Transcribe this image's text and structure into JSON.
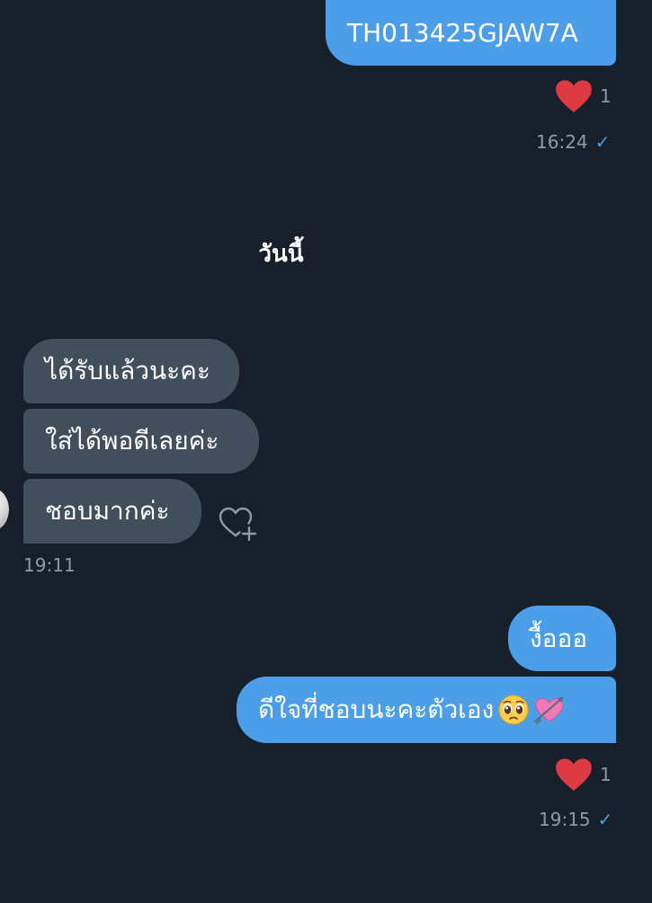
{
  "conversation": {
    "date_divider": "วันนี้",
    "messages": [
      {
        "direction": "out",
        "text": "TH013425GJAW7A",
        "reaction": {
          "emoji": "heart",
          "count": "1"
        },
        "time": "16:24",
        "read": true
      },
      {
        "direction": "in",
        "text": "ได้รับแล้วนะคะ"
      },
      {
        "direction": "in",
        "text": "ใส่ได้พอดีเลยค่ะ"
      },
      {
        "direction": "in",
        "text": "ชอบมากค่ะ",
        "time": "19:11"
      },
      {
        "direction": "out",
        "text": "งื้อออ"
      },
      {
        "direction": "out",
        "text": "ดีใจที่ชอบนะคะตัวเอง",
        "emojis": [
          "pleading-face",
          "heart-with-arrow"
        ],
        "reaction": {
          "emoji": "heart",
          "count": "1"
        },
        "time": "19:15",
        "read": true
      }
    ]
  },
  "colors": {
    "background": "#171f2a",
    "outgoing_bubble": "#4c9ee8",
    "incoming_bubble": "#414e5c",
    "heart": "#dd3a44",
    "meta_text": "#8e99a6"
  },
  "icons": {
    "reaction": "heart-icon",
    "add_reaction": "heart-plus-icon",
    "read_receipt": "checkmark-icon"
  },
  "checkmark": "✓"
}
